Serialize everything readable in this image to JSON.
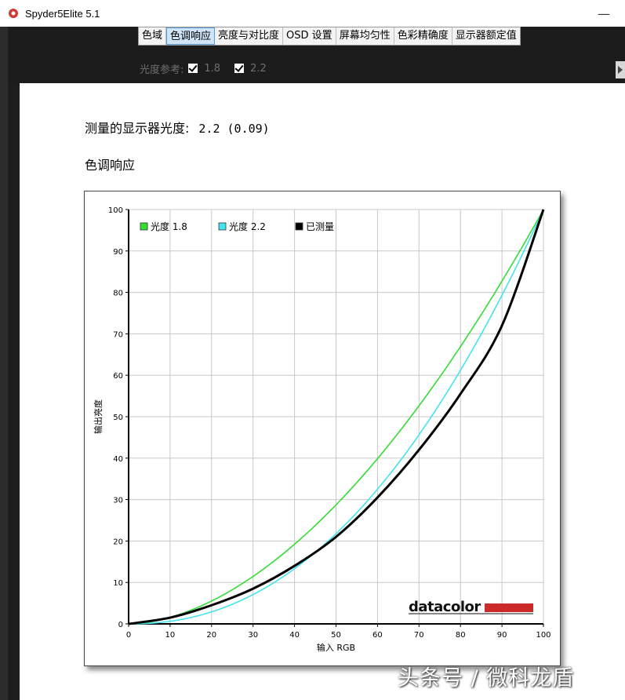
{
  "window": {
    "title": "Spyder5Elite 5.1",
    "minimize_glyph": "—"
  },
  "tabs": [
    {
      "label": "色域",
      "active": false
    },
    {
      "label": "色调响应",
      "active": true
    },
    {
      "label": "亮度与对比度",
      "active": false
    },
    {
      "label": "OSD 设置",
      "active": false
    },
    {
      "label": "屏幕均匀性",
      "active": false
    },
    {
      "label": "色彩精确度",
      "active": false
    },
    {
      "label": "显示器额定值",
      "active": false
    }
  ],
  "reference": {
    "label": "光度参考:",
    "options": [
      {
        "label": "1.8",
        "checked": true
      },
      {
        "label": "2.2",
        "checked": true
      }
    ]
  },
  "measurement": {
    "label": "测量的显示器光度:",
    "value": "2.2 (0.09)"
  },
  "section_title": "色调响应",
  "chart_data": {
    "type": "line",
    "xlabel": "输入 RGB",
    "ylabel": "输出亮度",
    "xlim": [
      0,
      100
    ],
    "ylim": [
      0,
      100
    ],
    "x_ticks": [
      0,
      10,
      20,
      30,
      40,
      50,
      60,
      70,
      80,
      90,
      100
    ],
    "y_ticks": [
      0,
      10,
      20,
      30,
      40,
      50,
      60,
      70,
      80,
      90,
      100
    ],
    "grid": true,
    "legend_position": "top-left",
    "series": [
      {
        "name": "光度 1.8",
        "color": "#33dd33",
        "gamma": 1.8
      },
      {
        "name": "光度 2.2",
        "color": "#44e4ee",
        "gamma": 2.2
      },
      {
        "name": "已测量",
        "color": "#000000",
        "x": [
          0,
          10,
          20,
          30,
          40,
          50,
          60,
          70,
          80,
          90,
          100
        ],
        "y": [
          0,
          1.5,
          4.5,
          8.5,
          14,
          21,
          30.5,
          42,
          55.5,
          72,
          100
        ]
      }
    ],
    "logo": {
      "text": "datacolor",
      "bar_color": "#cc2a2a"
    }
  },
  "watermark": "头条号 / 微科龙盾"
}
